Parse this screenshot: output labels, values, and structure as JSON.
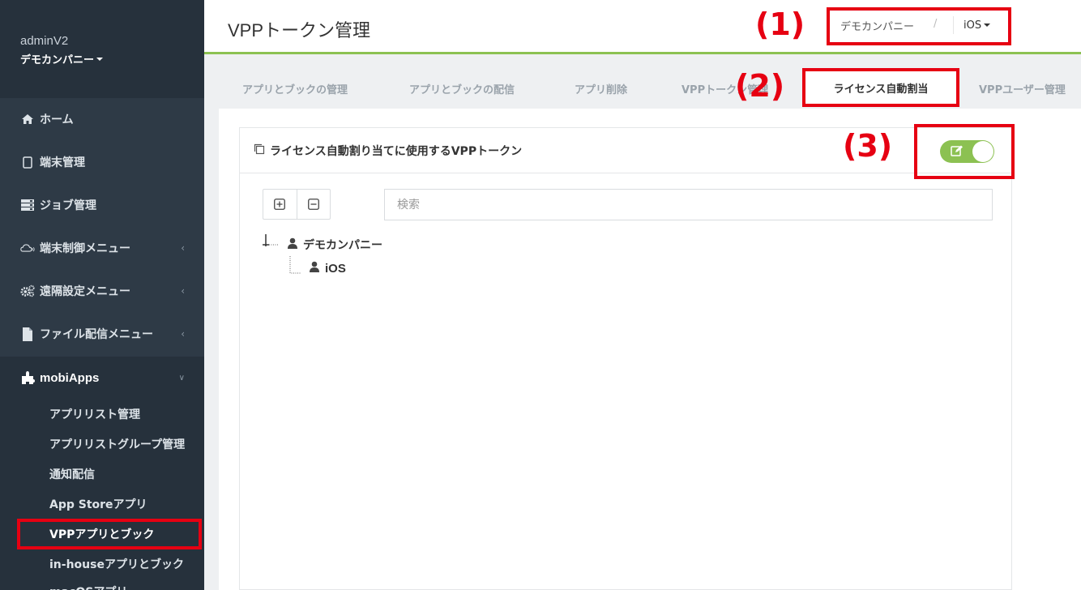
{
  "sidebar": {
    "user": "adminV2",
    "company": "デモカンパニー",
    "items": [
      {
        "label": "ホーム",
        "icon": "home-icon"
      },
      {
        "label": "端末管理",
        "icon": "tablet-icon"
      },
      {
        "label": "ジョブ管理",
        "icon": "server-icon"
      },
      {
        "label": "端末制御メニュー",
        "icon": "cloud-icon"
      },
      {
        "label": "遠隔設定メニュー",
        "icon": "cogs-icon"
      },
      {
        "label": "ファイル配信メニュー",
        "icon": "file-icon"
      },
      {
        "label": "mobiApps",
        "icon": "puzzle-icon"
      }
    ],
    "sub_items": [
      "アプリリスト管理",
      "アプリリストグループ管理",
      "通知配信",
      "App Storeアプリ",
      "VPPアプリとブック",
      "in-houseアプリとブック",
      "macOSアプリ"
    ]
  },
  "header": {
    "title": "VPPトークン管理",
    "breadcrumb_company": "デモカンパニー",
    "breadcrumb_sep": "/",
    "breadcrumb_os": "iOS"
  },
  "tabs": [
    "アプリとブックの管理",
    "アプリとブックの配信",
    "アプリ削除",
    "VPPトークン管理",
    "ライセンス自動割当",
    "VPPユーザー管理"
  ],
  "panel": {
    "title": "ライセンス自動割り当てに使用するVPPトークン",
    "search_placeholder": "検索",
    "tree_root": "デモカンパニー",
    "tree_child": "iOS",
    "toggle_on": true
  },
  "annotations": [
    "(1)",
    "(2)",
    "(3)"
  ],
  "colors": {
    "accent_green": "#8cc152",
    "highlight_red": "#e60012",
    "sidebar_bg": "#2e3a46"
  }
}
